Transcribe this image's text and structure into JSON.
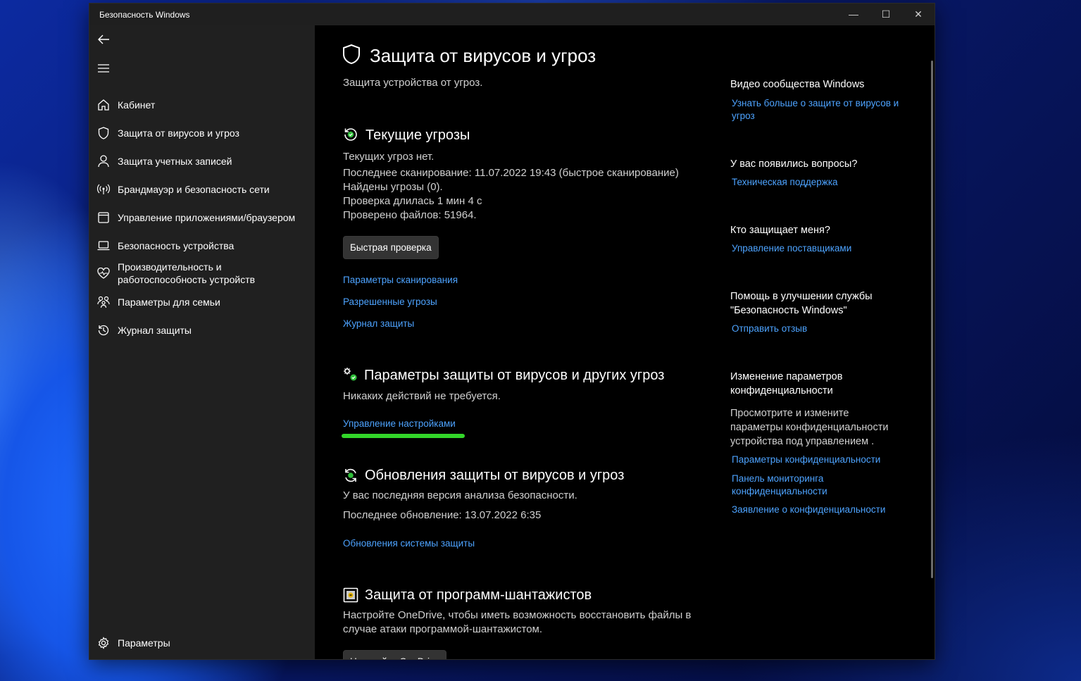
{
  "window": {
    "title": "Безопасность Windows",
    "controls": {
      "minimize": "—",
      "maximize": "☐",
      "close": "✕"
    }
  },
  "sidebar": {
    "items": [
      {
        "label": "Кабинет",
        "icon": "home-icon"
      },
      {
        "label": "Защита от вирусов и угроз",
        "icon": "shield-icon"
      },
      {
        "label": "Защита учетных записей",
        "icon": "person-icon"
      },
      {
        "label": "Брандмауэр и безопасность сети",
        "icon": "wifi-antenna-icon"
      },
      {
        "label": "Управление приложениями/браузером",
        "icon": "app-window-icon"
      },
      {
        "label": "Безопасность устройства",
        "icon": "laptop-icon"
      },
      {
        "label": "Производительность и работоспособность устройств",
        "icon": "heart-pulse-icon"
      },
      {
        "label": "Параметры для семьи",
        "icon": "family-icon"
      },
      {
        "label": "Журнал защиты",
        "icon": "history-icon"
      }
    ],
    "settings_label": "Параметры"
  },
  "main": {
    "title": "Защита от вирусов и угроз",
    "subtitle": "Защита устройства от угроз.",
    "current_threats": {
      "title": "Текущие угрозы",
      "lines": [
        "Текущих угроз нет.",
        "Последнее сканирование: 11.07.2022 19:43 (быстрое сканирование)",
        "Найдены угрозы (0).",
        "Проверка длилась 1 мин 4 с",
        "Проверено файлов: 51964."
      ],
      "quick_scan_button": "Быстрая проверка",
      "links": [
        "Параметры сканирования",
        "Разрешенные угрозы",
        "Журнал защиты"
      ]
    },
    "protection_settings": {
      "title": "Параметры защиты от вирусов и других угроз",
      "status": "Никаких действий не требуется.",
      "link": "Управление настройками"
    },
    "updates": {
      "title": "Обновления защиты от вирусов и угроз",
      "line1": "У вас последняя версия анализа безопасности.",
      "line2": "Последнее обновление: 13.07.2022 6:35",
      "link": "Обновления системы защиты"
    },
    "ransomware": {
      "title": "Защита от программ-шантажистов",
      "text": "Настройте OneDrive, чтобы иметь возможность восстановить файлы в случае атаки программой-шантажистом.",
      "button": "Настройка OneDrive"
    }
  },
  "right_panel": {
    "community": {
      "title": "Видео сообщества Windows",
      "link": "Узнать больше о защите от вирусов и угроз"
    },
    "questions": {
      "title": "У вас появились вопросы?",
      "link": "Техническая поддержка"
    },
    "who_protects": {
      "title": "Кто защищает меня?",
      "link": "Управление поставщиками"
    },
    "feedback": {
      "title": "Помощь в улучшении службы \"Безопасность Windows\"",
      "link": "Отправить отзыв"
    },
    "privacy": {
      "title": "Изменение параметров конфиденциальности",
      "text": "Просмотрите и измените параметры конфиденциальности устройства под управлением .",
      "links": [
        "Параметры конфиденциальности",
        "Панель мониторинга конфиденциальности",
        "Заявление о конфиденциальности"
      ]
    }
  },
  "colors": {
    "link": "#4da3ff",
    "highlight": "#33d62a",
    "sidebar_bg": "#202020",
    "main_bg": "#000000"
  }
}
